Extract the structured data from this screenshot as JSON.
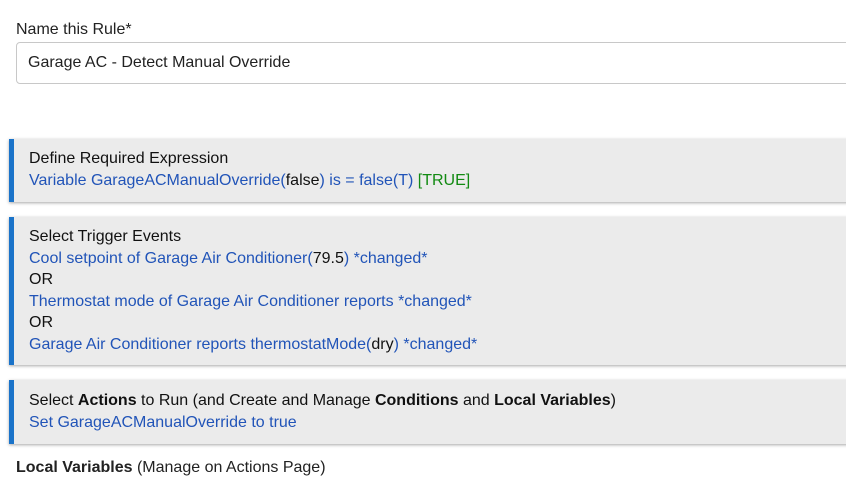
{
  "rule_name": {
    "label": "Name this Rule*",
    "value": "Garage AC - Detect Manual Override"
  },
  "required_expression": {
    "title": "Define Required Expression",
    "variable_prefix": "Variable GarageACManualOverride(",
    "variable_value": "false",
    "comparison": ") is = false(T)",
    "result": "[TRUE]"
  },
  "triggers": {
    "title": "Select Trigger Events",
    "or_label": "OR",
    "items": [
      {
        "prefix": "Cool setpoint of Garage Air Conditioner(",
        "value": "79.5",
        "suffix": ") *changed*"
      },
      {
        "text": "Thermostat mode of Garage Air Conditioner reports *changed*"
      },
      {
        "prefix": "Garage Air Conditioner reports thermostatMode(",
        "value": "dry",
        "suffix": ") *changed*"
      }
    ]
  },
  "actions": {
    "title_parts": [
      "Select ",
      "Actions",
      " to Run (and Create and Manage ",
      "Conditions",
      " and ",
      "Local Variables",
      ")"
    ],
    "items": [
      "Set GarageACManualOverride to true"
    ]
  },
  "local_variables": {
    "label": "Local Variables",
    "note": "(Manage on Actions Page)"
  },
  "colors": {
    "accent": "#1a73c9",
    "link": "#2154b8",
    "true_green": "#128a12",
    "section_bg": "#ebebeb"
  }
}
